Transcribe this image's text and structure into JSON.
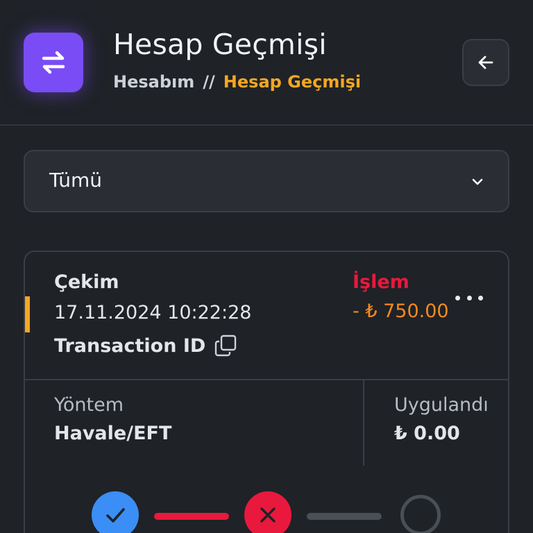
{
  "header": {
    "title": "Hesap Geçmişi",
    "breadcrumb": {
      "home": "Hesabım",
      "separator": "//",
      "current": "Hesap Geçmişi"
    },
    "icon": "swap-arrows-icon",
    "back_icon": "arrow-left-icon"
  },
  "filter": {
    "selected": "Tümü",
    "icon": "chevron-down-icon"
  },
  "transaction": {
    "type": "Çekim",
    "datetime": "17.11.2024 10:22:28",
    "id_label": "Transaction ID",
    "status": "İşlem",
    "amount": "- ₺ 750.00",
    "method_label": "Yöntem",
    "method_value": "Havale/EFT",
    "applied_label": "Uygulandı",
    "applied_value": "₺ 0.00",
    "steps": [
      "completed",
      "failed",
      "pending"
    ]
  },
  "colors": {
    "accent_purple": "#7a4cf5",
    "accent_orange": "#f5a623",
    "status_red": "#e8193c",
    "amount_orange": "#f58a1f",
    "step_blue": "#3b8ef5",
    "background": "#1f2227"
  }
}
